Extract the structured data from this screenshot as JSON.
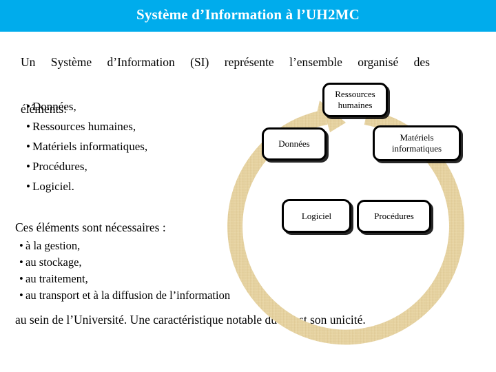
{
  "header": {
    "title": "Système d’Information  à  l’UH2MC",
    "band_color": "#00ACEC",
    "title_color": "#FFFFFF"
  },
  "body": {
    "intro_line_1": "Un  Système  d’Information  (SI)  représente  l’ensemble  organisé  des",
    "intro_line_2": "éléments:",
    "elements_bullets": [
      "Données,",
      "Ressources humaines,",
      "Matériels informatiques,",
      "Procédures,",
      "Logiciel."
    ],
    "needs_heading": "Ces éléments sont nécessaires :",
    "needs_bullets": [
      "à la gestion,",
      "au stockage,",
      "au traitement,",
      "au transport et à la diffusion de l’information"
    ],
    "closing_paragraph": "au sein de l’Université. Une caractéristique notable du SI est son unicité.",
    "bullet_glyph": "•"
  },
  "diagram": {
    "arrow_color": "#E8D6A6",
    "arrow_shadow_color": "#D6C38F",
    "box_border_color": "#000000",
    "box_fill_color": "#FFFFFF",
    "boxes": [
      {
        "id": "ressources-humaines",
        "line1": "Ressources",
        "line2": "humaines"
      },
      {
        "id": "donnees",
        "line1": "Données",
        "line2": ""
      },
      {
        "id": "materiels",
        "line1": "Matériels",
        "line2": "informatiques"
      },
      {
        "id": "logiciel",
        "line1": "Logiciel",
        "line2": ""
      },
      {
        "id": "procedures",
        "line1": "Procédures",
        "line2": ""
      }
    ]
  }
}
